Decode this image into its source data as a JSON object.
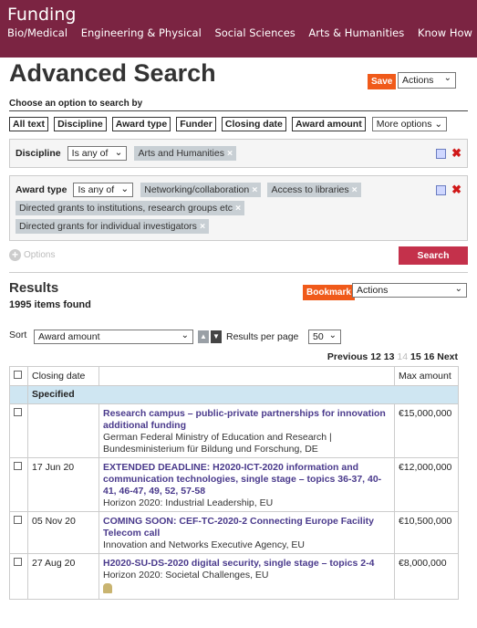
{
  "header": {
    "brand": "Funding",
    "nav": [
      "Bio/Medical",
      "Engineering & Physical",
      "Social Sciences",
      "Arts & Humanities",
      "Know How"
    ]
  },
  "title": "Advanced Search",
  "save_label": "Save",
  "actions_label": "Actions",
  "choose_label": "Choose an option to search by",
  "filters": [
    "All text",
    "Discipline",
    "Award type",
    "Funder",
    "Closing date",
    "Award amount"
  ],
  "more_options": "More options",
  "criteria": [
    {
      "label": "Discipline",
      "operator": "Is any of",
      "tags": [
        "Arts and Humanities"
      ]
    },
    {
      "label": "Award type",
      "operator": "Is any of",
      "tags": [
        "Networking/collaboration",
        "Access to libraries",
        "Directed grants to institutions, research groups etc",
        "Directed grants for individual investigators"
      ]
    }
  ],
  "options_label": "Options",
  "search_label": "Search",
  "results": {
    "title": "Results",
    "count": "1995 items found",
    "bookmark_label": "Bookmark",
    "actions_label": "Actions"
  },
  "sort": {
    "label": "Sort",
    "value": "Award amount",
    "per_page_label": "Results per page",
    "per_page_value": "50"
  },
  "pager": {
    "previous": "Previous",
    "pages": [
      "12",
      "13",
      "14",
      "15",
      "16"
    ],
    "current": "14",
    "next": "Next"
  },
  "table": {
    "col_closing": "Closing date",
    "col_max": "Max amount",
    "section": "Specified",
    "rows": [
      {
        "date": "",
        "title": "Research campus – public-private partnerships for innovation additional funding",
        "funder": "German Federal Ministry of Education and Research | Bundesministerium für Bildung und Forschung, DE",
        "amount": "€15,000,000"
      },
      {
        "date": "17 Jun 20",
        "title": "EXTENDED DEADLINE: H2020-ICT-2020 information and communication technologies, single stage – topics 36-37, 40-41, 46-47, 49, 52, 57-58",
        "funder": "Horizon 2020: Industrial Leadership, EU",
        "amount": "€12,000,000"
      },
      {
        "date": "05 Nov 20",
        "title": "COMING SOON: CEF-TC-2020-2 Connecting Europe Facility Telecom call",
        "funder": "Innovation and Networks Executive Agency, EU",
        "amount": "€10,500,000"
      },
      {
        "date": "27 Aug 20",
        "title": "H2020-SU-DS-2020 digital security, single stage – topics 2-4",
        "funder": "Horizon 2020: Societal Challenges, EU",
        "amount": "€8,000,000"
      }
    ]
  }
}
